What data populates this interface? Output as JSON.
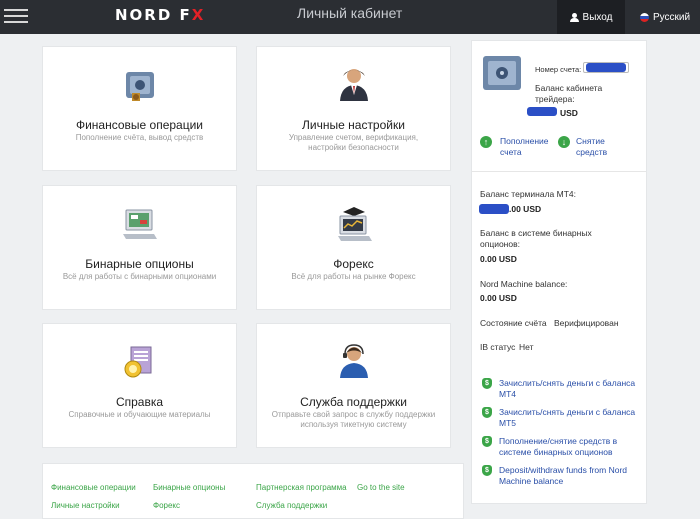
{
  "header": {
    "logo_left": "NORD F",
    "logo_right": "X",
    "title": "Личный кабинет",
    "logout": "Выход",
    "language": "Русский"
  },
  "cards": [
    {
      "title": "Финансовые операции",
      "sub": "Пополнение счёта, вывод средств",
      "icon": "safe-icon"
    },
    {
      "title": "Личные настройки",
      "sub": "Управление счетом, верификация, настройки безопасности",
      "icon": "user-settings-icon"
    },
    {
      "title": "Бинарные опционы",
      "sub": "Всё для работы с бинарными опционами",
      "icon": "binary-options-icon"
    },
    {
      "title": "Форекс",
      "sub": "Всё для работы на рынке Форекс",
      "icon": "forex-icon"
    },
    {
      "title": "Справка",
      "sub": "Справочные и обучающие материалы",
      "icon": "help-icon"
    },
    {
      "title": "Служба поддержки",
      "sub": "Отправьте свой запрос в службу поддержки используя тикетную систему",
      "icon": "support-icon"
    }
  ],
  "footer": {
    "links": [
      "Финансовые операции",
      "Бинарные опционы",
      "Партнерская программа",
      "Go to the site",
      "Личные настройки",
      "Форекс",
      "Служба поддержки"
    ]
  },
  "sidebar": {
    "account_label": "Номер счета:",
    "cabinet_balance_label": "Баланс кабинета трейдера:",
    "cabinet_balance_currency": "USD",
    "deposit": "Пополнение счета",
    "withdraw": "Снятие средств",
    "mt4_label": "Баланс терминала MT4:",
    "mt4_value_suffix": ".00 USD",
    "binary_label": "Баланс в системе бинарных опционов:",
    "binary_value": "0.00 USD",
    "nm_label": "Nord Machine balance:",
    "nm_value": "0.00 USD",
    "status_label": "Состояние счёта",
    "status_value": "Верифицирован",
    "ib_label": "IB статус",
    "ib_value": "Нет",
    "transfers": [
      "Зачислить/снять деньги с баланса MT4",
      "Зачислить/снять деньги с баланса MT5",
      "Пополнение/снятие средств в системе бинарных опционов",
      "Deposit/withdraw funds from Nord Machine balance"
    ]
  },
  "colors": {
    "header_bg": "#2b2e33",
    "accent_green": "#3ba548",
    "logo_red": "#e32127",
    "link_blue": "#2a4fa8",
    "status_red": "#e02020"
  }
}
